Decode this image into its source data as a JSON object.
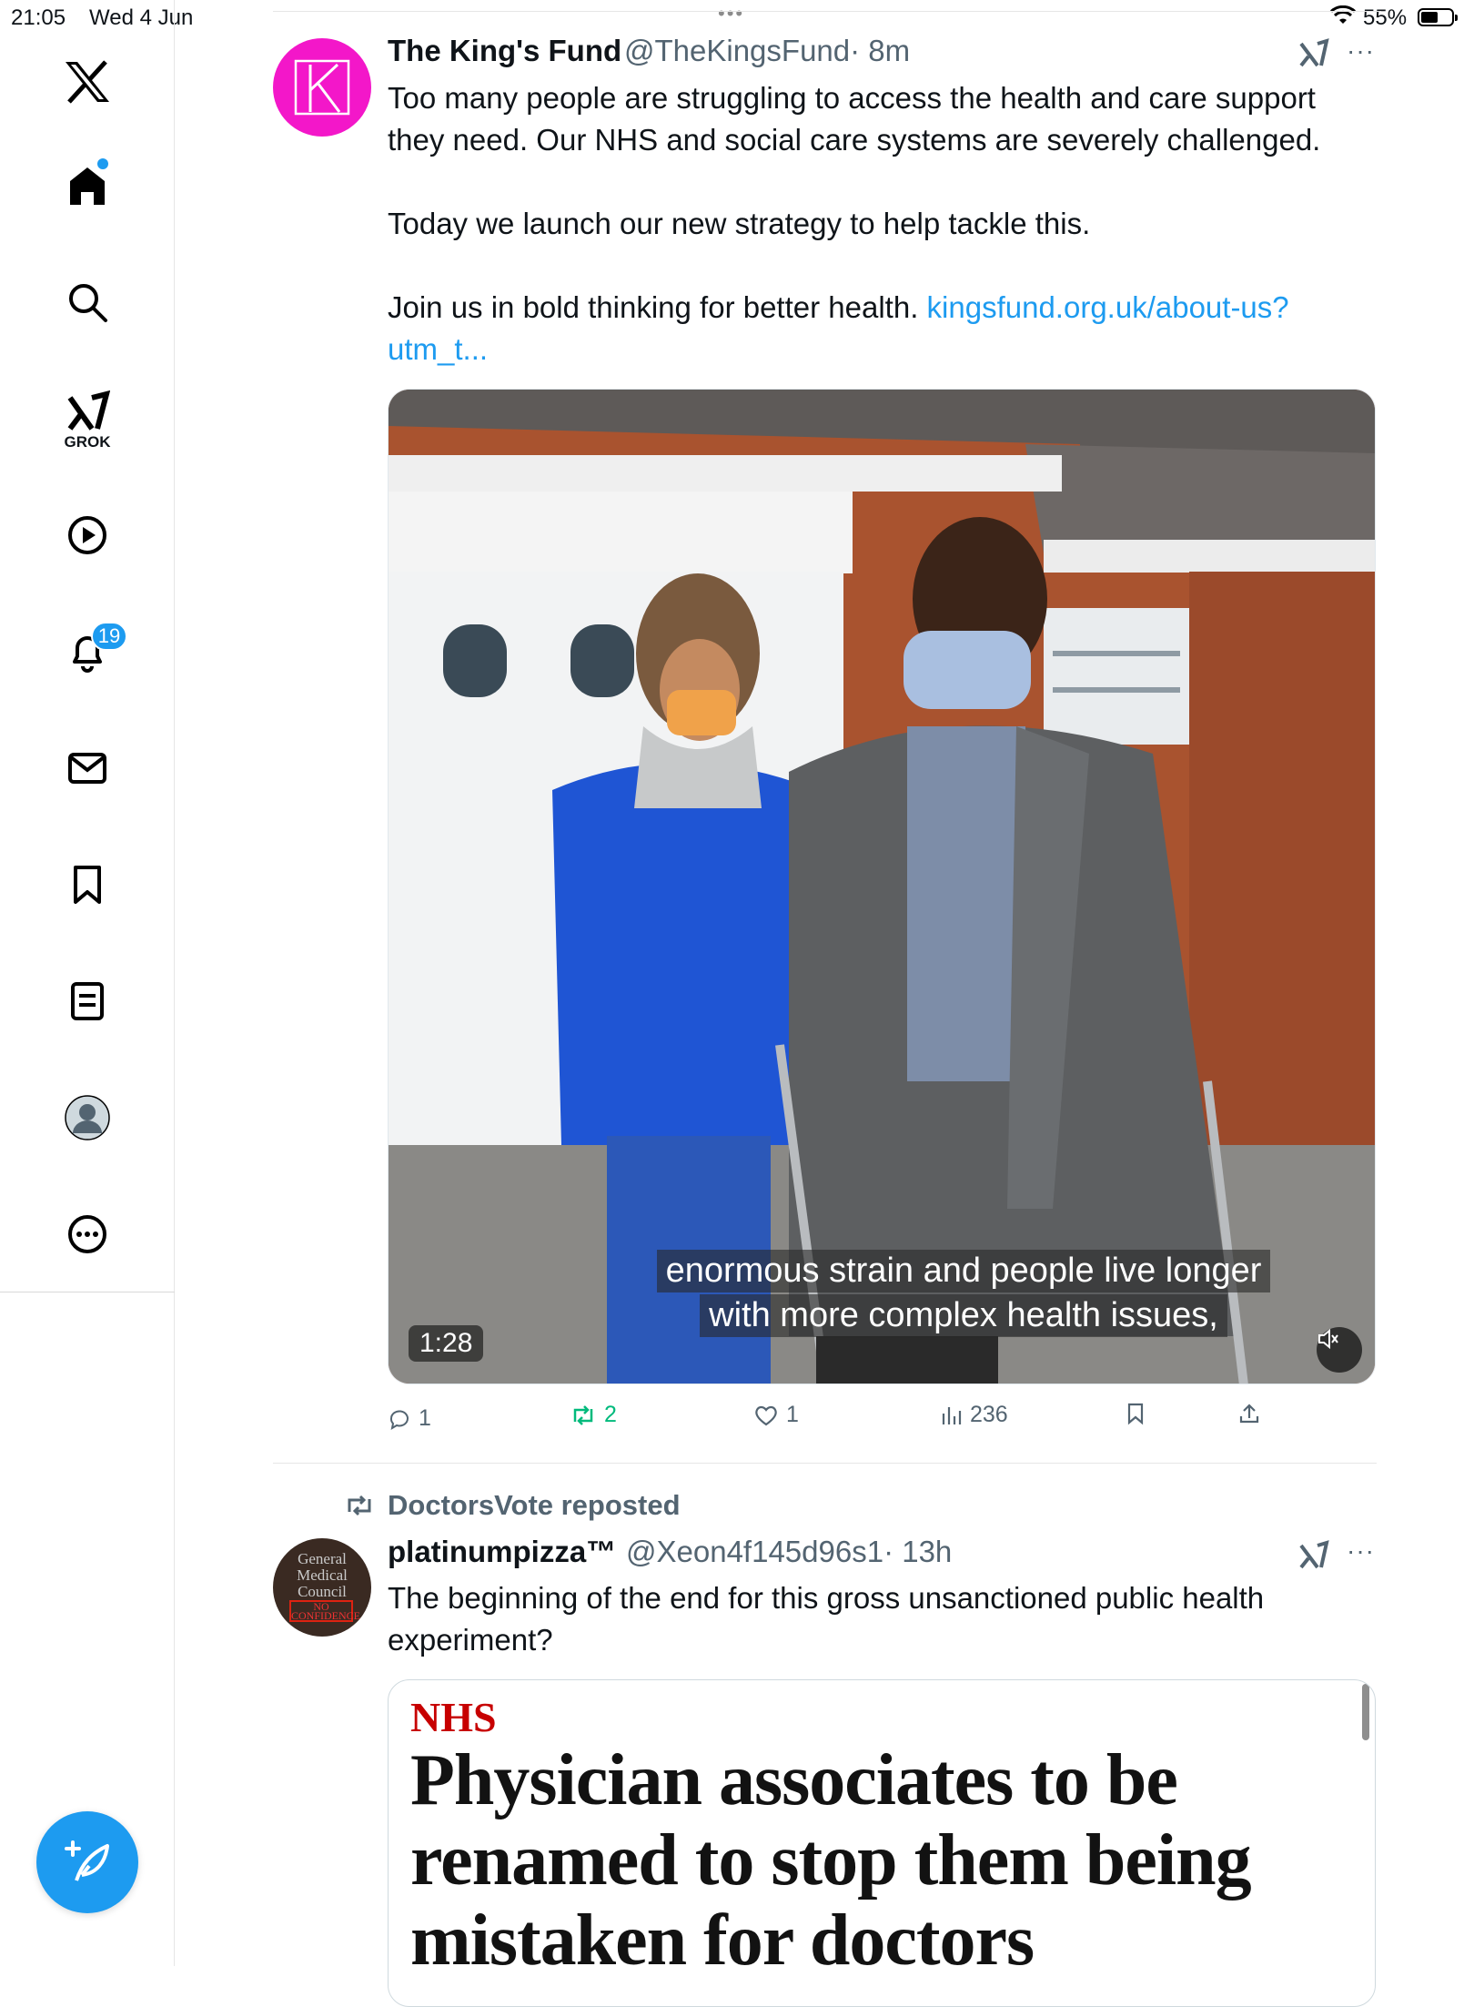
{
  "status_bar": {
    "time": "21:05",
    "date": "Wed 4 Jun",
    "battery": "55%",
    "dots": "•••"
  },
  "sidebar": {
    "items": [
      {
        "name": "x-logo",
        "label": ""
      },
      {
        "name": "home",
        "label": ""
      },
      {
        "name": "explore",
        "label": ""
      },
      {
        "name": "grok",
        "label": "GROK"
      },
      {
        "name": "video",
        "label": ""
      },
      {
        "name": "notifications",
        "label": "",
        "badge": "19"
      },
      {
        "name": "messages",
        "label": ""
      },
      {
        "name": "bookmarks",
        "label": ""
      },
      {
        "name": "lists",
        "label": ""
      },
      {
        "name": "profile",
        "label": ""
      },
      {
        "name": "more",
        "label": ""
      }
    ],
    "accent": "#1d9bf0"
  },
  "tweet1": {
    "name": "The King's Fund",
    "handle": "@TheKingsFund",
    "time": "· 8m",
    "more": "···",
    "text_line1": "Too many people are struggling to access the health and care support",
    "text_line2": "they need. Our NHS and social care systems are severely challenged.",
    "text_line3": "Today we launch our new strategy to help tackle this.",
    "text_line4": "Join us in bold thinking for better health.",
    "link_part1": "kingsfund.org.uk/about-us?",
    "link_part2": "utm_t...",
    "video": {
      "subtitle_line1": "enormous strain and people live longer",
      "subtitle_line2": "with more complex health issues,",
      "duration": "1:28"
    },
    "actions": {
      "replies": "1",
      "reposts": "2",
      "likes": "1",
      "views": "236"
    },
    "brand_color": "#f317c9"
  },
  "tweet2": {
    "repost_label": "DoctorsVote reposted",
    "name": "platinumpizza™",
    "handle": "@Xeon4f145d96s1",
    "time": "· 13h",
    "more": "···",
    "text_line1": "The beginning of the end for this gross unsanctioned public health",
    "text_line2": "experiment?",
    "avatar_text": [
      "General",
      "Medical",
      "Council"
    ],
    "avatar_stamp": "NO CONFIDENCE",
    "card": {
      "section": "NHS",
      "headline_line1": "Physician associates to be",
      "headline_line2": "renamed to stop them being",
      "headline_line3": "mistaken for doctors"
    }
  }
}
